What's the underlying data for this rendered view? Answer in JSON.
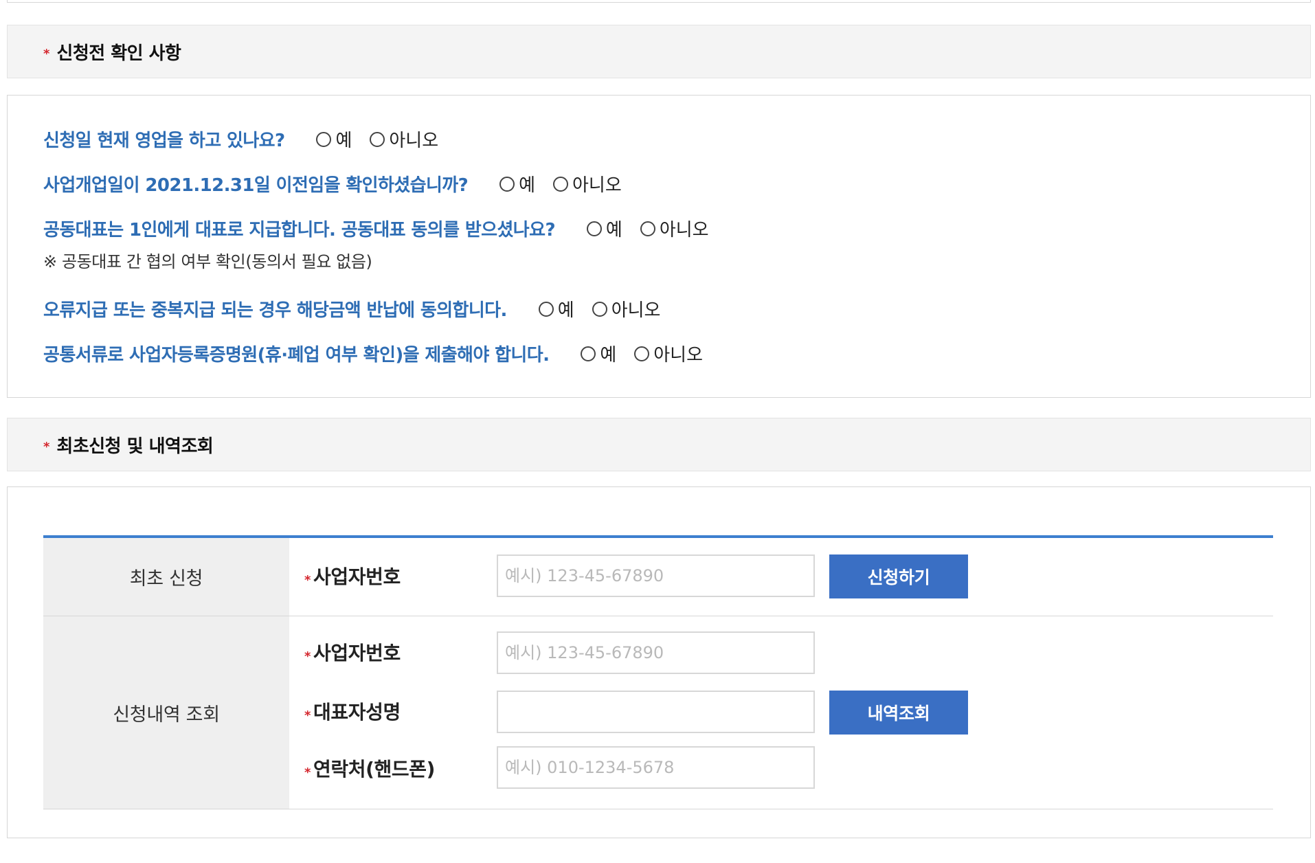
{
  "sections": {
    "precheck": {
      "star": "*",
      "title": "신청전 확인 사항"
    },
    "apply": {
      "star": "*",
      "title": "최초신청 및 내역조회"
    }
  },
  "questions": [
    {
      "text": "신청일 현재 영업을 하고 있나요?",
      "yes": "예",
      "no": "아니오"
    },
    {
      "text": "사업개업일이 2021.12.31일 이전임을 확인하셨습니까?",
      "yes": "예",
      "no": "아니오"
    },
    {
      "text": "공동대표는 1인에게 대표로 지급합니다. 공동대표 동의를 받으셨나요?",
      "yes": "예",
      "no": "아니오"
    },
    {
      "text": "오류지급 또는 중복지급 되는 경우 해당금액 반납에 동의합니다.",
      "yes": "예",
      "no": "아니오"
    },
    {
      "text": "공통서류로 사업자등록증명원(휴·폐업 여부 확인)을 제출해야 합니다.",
      "yes": "예",
      "no": "아니오"
    }
  ],
  "note": "※ 공동대표 간 협의 여부 확인(동의서 필요 없음)",
  "first_apply": {
    "head": "최초 신청",
    "biz_label": "사업자번호",
    "biz_placeholder": "예시) 123-45-67890",
    "button": "신청하기"
  },
  "history": {
    "head": "신청내역 조회",
    "biz_label": "사업자번호",
    "biz_placeholder": "예시) 123-45-67890",
    "name_label": "대표자성명",
    "name_placeholder": "",
    "phone_label": "연락처(핸드폰)",
    "phone_placeholder": "예시) 010-1234-5678",
    "button": "내역조회"
  },
  "required_mark": "*",
  "colors": {
    "question": "#2e6db4",
    "accent": "#3a6fc4",
    "required": "#d4262d",
    "table_border": "#3d7fcf"
  }
}
